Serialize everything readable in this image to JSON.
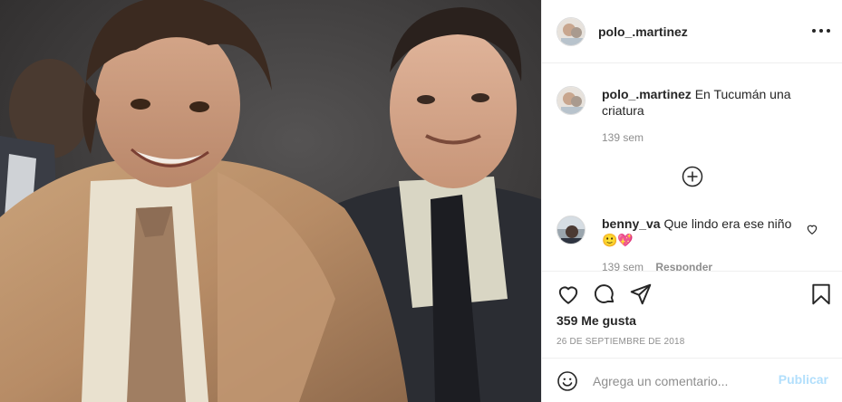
{
  "post": {
    "username": "polo_.martinez",
    "more_icon": "more-horizontal-icon"
  },
  "caption": {
    "username": "polo_.martinez",
    "text": "En Tucumán una criatura",
    "time": "139 sem"
  },
  "comment": {
    "username": "benny_va",
    "text": "Que lindo era ese niño",
    "emoji": "🙂💖",
    "time": "139 sem",
    "reply_label": "Responder"
  },
  "actions": {
    "icons": [
      "heart-icon",
      "comment-icon",
      "share-icon",
      "bookmark-icon"
    ],
    "likes": "359 Me gusta",
    "date": "26 DE SEPTIEMBRE DE 2018"
  },
  "add_comment": {
    "placeholder": "Agrega un comentario...",
    "publish_label": "Publicar"
  },
  "colors": {
    "publish_disabled": "#b2dffc",
    "secondary_text": "#8e8e8e",
    "border": "#efefef"
  }
}
